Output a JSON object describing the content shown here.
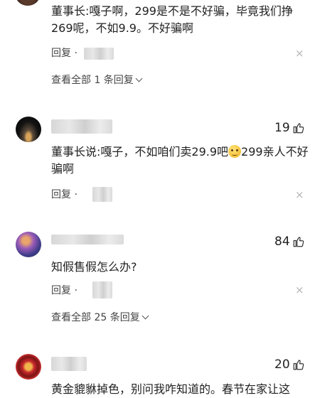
{
  "comments": [
    {
      "text": "董事长:嘎子啊，299是不是不好骗，毕竟我们挣269呢，不如9.9。不好骗啊",
      "reply_label": "回复 ·",
      "view_all": "查看全部 1 条回复"
    },
    {
      "likes": "19",
      "text_before_emoji": "董事长说:嘎子，不如咱们卖29.9吧",
      "emoji_name": "thinking-face-emoji",
      "text_after_emoji": "299亲人不好骗啊",
      "reply_label": "回复 ·"
    },
    {
      "likes": "84",
      "text": "知假售假怎么办?",
      "reply_label": "回复 ·",
      "view_all": "查看全部 25 条回复"
    },
    {
      "likes": "20",
      "text": "黄金貔貅掉色，别问我咋知道的。春节在家让这"
    }
  ],
  "close_icon_glyph": "×",
  "colors": {
    "text": "#222222",
    "secondary": "#444444",
    "close": "#b5b5b5"
  }
}
